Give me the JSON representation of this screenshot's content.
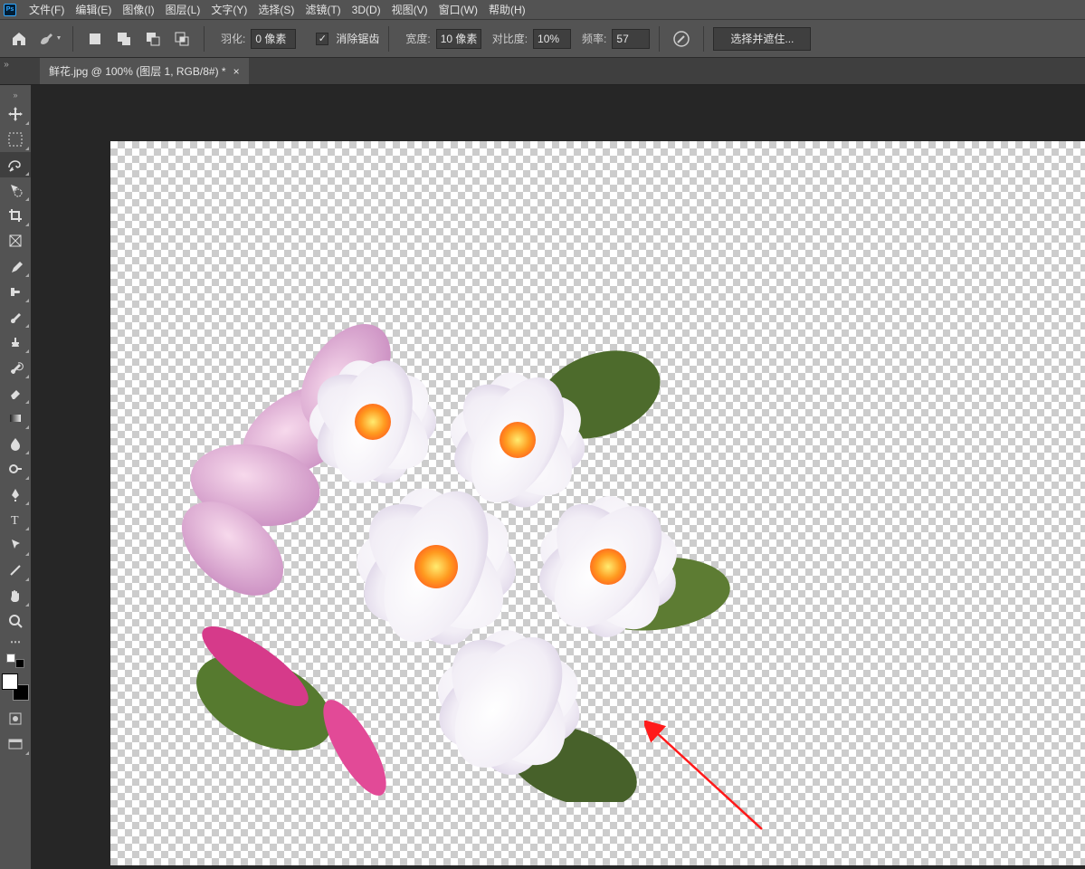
{
  "app": {
    "logo_text": "Ps"
  },
  "menu": {
    "file": "文件(F)",
    "edit": "编辑(E)",
    "image": "图像(I)",
    "layer": "图层(L)",
    "type": "文字(Y)",
    "select": "选择(S)",
    "filter": "滤镜(T)",
    "three_d": "3D(D)",
    "view": "视图(V)",
    "window": "窗口(W)",
    "help": "帮助(H)"
  },
  "options": {
    "feather_label": "羽化:",
    "feather_value": "0 像素",
    "anti_alias": "消除锯齿",
    "width_label": "宽度:",
    "width_value": "10 像素",
    "contrast_label": "对比度:",
    "contrast_value": "10%",
    "frequency_label": "频率:",
    "frequency_value": "57",
    "select_and_mask": "选择并遮住..."
  },
  "tab": {
    "title": "鲜花.jpg @ 100% (图层 1, RGB/8#) *",
    "close": "×"
  },
  "tools": {
    "move": "move-tool",
    "marquee": "rectangular-marquee-tool",
    "lasso": "magnetic-lasso-tool",
    "magic": "quick-selection-tool",
    "crop": "crop-tool",
    "frame": "frame-tool",
    "eyedropper": "eyedropper-tool",
    "heal": "healing-brush-tool",
    "brush": "brush-tool",
    "stamp": "clone-stamp-tool",
    "history": "history-brush-tool",
    "eraser": "eraser-tool",
    "gradient": "gradient-tool",
    "blur": "blur-tool",
    "dodge": "dodge-tool",
    "pen": "pen-tool",
    "text": "text-tool",
    "path": "path-selection-tool",
    "line": "line-tool",
    "hand": "hand-tool",
    "zoom": "zoom-tool"
  },
  "colors": {
    "fg": "#ffffff",
    "bg": "#000000"
  }
}
